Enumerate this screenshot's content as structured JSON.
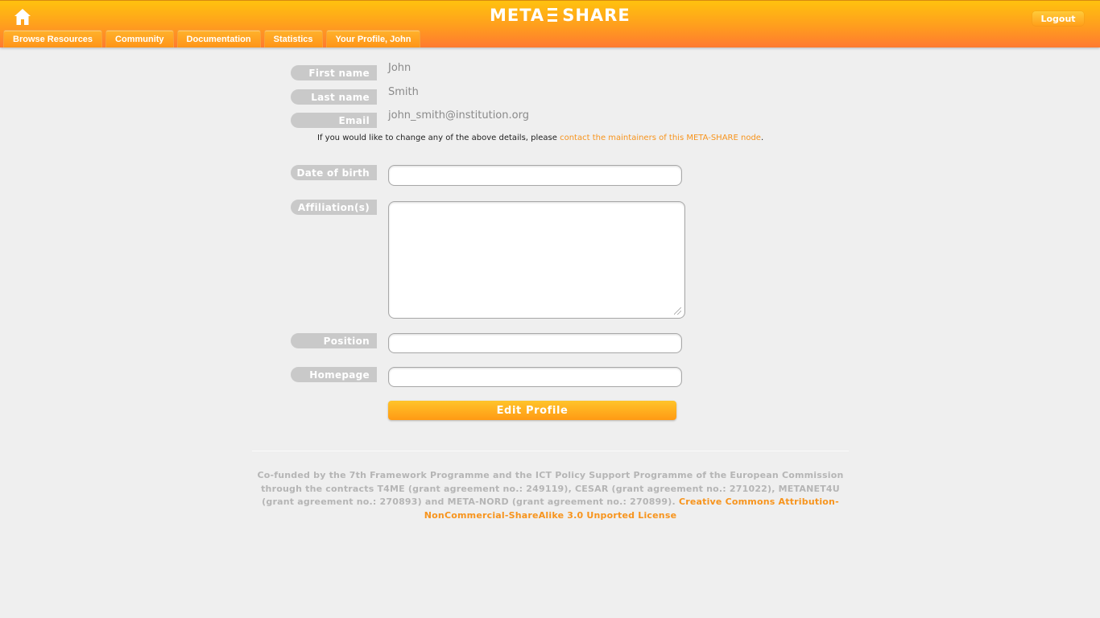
{
  "header": {
    "logo_left": "META",
    "logo_right": "SHARE",
    "logout_label": "Logout",
    "home_icon": "home-icon",
    "nav_tabs": [
      {
        "label": "Browse Resources"
      },
      {
        "label": "Community"
      },
      {
        "label": "Documentation"
      },
      {
        "label": "Statistics"
      },
      {
        "label": "Your Profile, John"
      }
    ]
  },
  "profile": {
    "first_name_label": "First name",
    "first_name_value": "John",
    "last_name_label": "Last name",
    "last_name_value": "Smith",
    "email_label": "Email",
    "email_value": "john_smith@institution.org",
    "note_prefix": "If you would like to change any of the above details, please ",
    "note_link": "contact the maintainers of this META-SHARE node",
    "note_suffix": "."
  },
  "form": {
    "dob_label": "Date of birth",
    "dob_value": "",
    "affiliations_label": "Affiliation(s)",
    "affiliations_value": "",
    "position_label": "Position",
    "position_value": "",
    "homepage_label": "Homepage",
    "homepage_value": "",
    "submit_label": "Edit Profile"
  },
  "footer": {
    "text": "Co-funded by the 7th Framework Programme and the ICT Policy Support Programme of the European Commission through the contracts T4ME (grant agreement no.: 249119), CESAR (grant agreement no.: 271022), METANET4U (grant agreement no.: 270893) and META-NORD (grant agreement no.: 270899). ",
    "license_link": "Creative Commons Attribution-NonCommercial-ShareAlike 3.0 Unported License"
  },
  "colors": {
    "accent": "#f7941d",
    "header_top": "#ffc20e",
    "header_bottom": "#ff7a30",
    "label_pill": "#c9c9c9",
    "background": "#efefef"
  }
}
